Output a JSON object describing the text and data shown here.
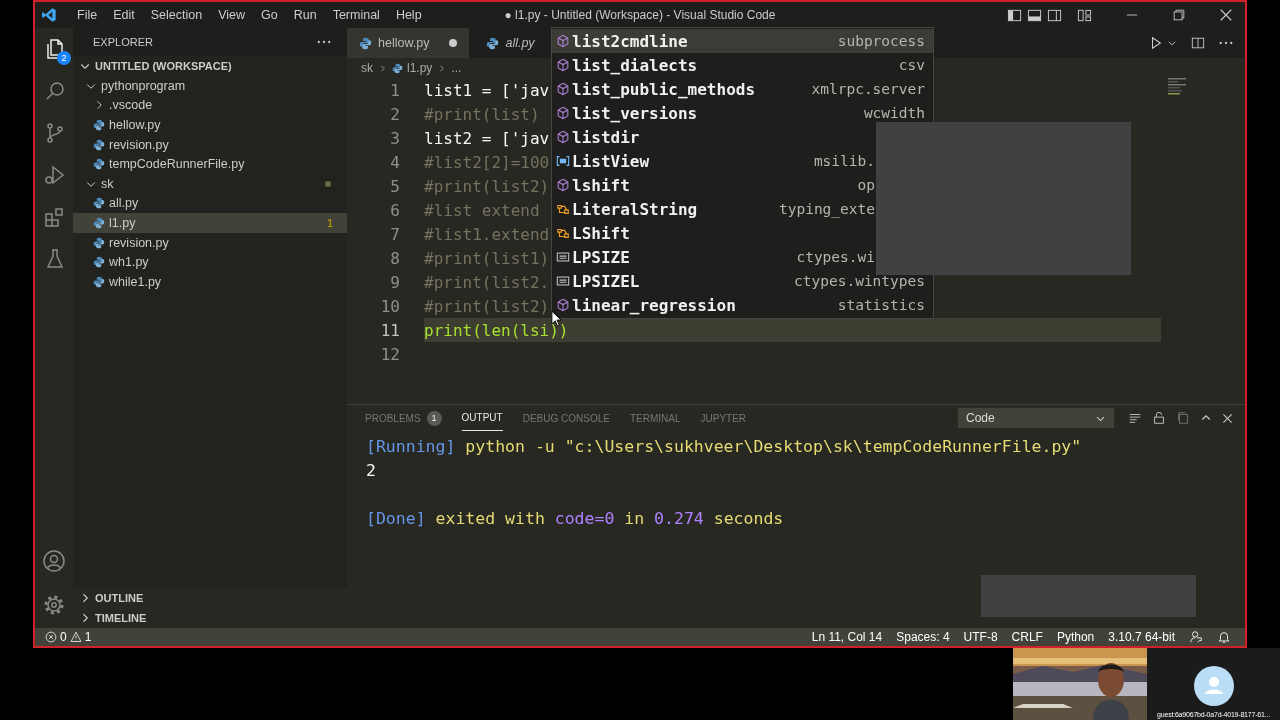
{
  "window": {
    "title": "● l1.py - Untitled (Workspace) - Visual Studio Code"
  },
  "menu": [
    "File",
    "Edit",
    "Selection",
    "View",
    "Go",
    "Run",
    "Terminal",
    "Help"
  ],
  "activity_bar": {
    "items": [
      {
        "kind": "explorer",
        "selected": true,
        "badge": "2"
      },
      {
        "kind": "search",
        "selected": false
      },
      {
        "kind": "source-control",
        "selected": false
      },
      {
        "kind": "run-debug",
        "selected": false
      },
      {
        "kind": "extensions",
        "selected": false
      },
      {
        "kind": "testing",
        "selected": false
      }
    ]
  },
  "sidebar": {
    "title": "EXPLORER",
    "workspace": {
      "label": "UNTITLED (WORKSPACE)",
      "expanded": true,
      "children": [
        {
          "kind": "folder",
          "label": "pythonprogram",
          "expanded": true,
          "selected": false,
          "children": [
            {
              "kind": "folder",
              "label": ".vscode",
              "expanded": false,
              "selected": false
            },
            {
              "kind": "file",
              "label": "hellow.py",
              "selected": false
            },
            {
              "kind": "file",
              "label": "revision.py",
              "selected": false
            },
            {
              "kind": "file",
              "label": "tempCodeRunnerFile.py",
              "selected": false
            }
          ]
        },
        {
          "kind": "folder",
          "label": "sk",
          "expanded": true,
          "selected": false,
          "modified": true,
          "children": [
            {
              "kind": "file",
              "label": "all.py",
              "selected": false
            },
            {
              "kind": "file",
              "label": "l1.py",
              "selected": true,
              "badge": "1"
            },
            {
              "kind": "file",
              "label": "revision.py",
              "selected": false
            },
            {
              "kind": "file",
              "label": "wh1.py",
              "selected": false
            },
            {
              "kind": "file",
              "label": "while1.py",
              "selected": false
            }
          ]
        }
      ]
    },
    "sections": [
      {
        "label": "OUTLINE",
        "expanded": false
      },
      {
        "label": "TIMELINE",
        "expanded": false
      }
    ]
  },
  "tabs": [
    {
      "label": "hellow.py",
      "selected": false,
      "dirty": true,
      "preview": false
    },
    {
      "label": "all.py",
      "selected": false,
      "dirty": false,
      "preview": true
    }
  ],
  "breadcrumb": [
    {
      "kind": "folder",
      "label": "sk"
    },
    {
      "kind": "file",
      "label": "l1.py"
    },
    {
      "kind": "symbol",
      "label": "..."
    }
  ],
  "editor": {
    "lines": [
      {
        "number": "1",
        "kind": "code",
        "text": "list1 = ['jav",
        "current": false
      },
      {
        "number": "2",
        "kind": "comment",
        "text": "#print(list)",
        "current": false
      },
      {
        "number": "3",
        "kind": "code",
        "text": "list2 = ['jav",
        "current": false
      },
      {
        "number": "4",
        "kind": "comment",
        "text": "#list2[2]=100",
        "current": false
      },
      {
        "number": "5",
        "kind": "comment",
        "text": "#print(list2)",
        "current": false
      },
      {
        "number": "6",
        "kind": "comment",
        "text": "#list extend",
        "current": false
      },
      {
        "number": "7",
        "kind": "comment",
        "text": "#list1.extend",
        "current": false
      },
      {
        "number": "8",
        "kind": "comment",
        "text": "#print(list1)",
        "current": false
      },
      {
        "number": "9",
        "kind": "comment",
        "text": "#print(list2.",
        "current": false
      },
      {
        "number": "10",
        "kind": "comment",
        "text": "#print(list2)",
        "current": false
      },
      {
        "number": "11",
        "kind": "call",
        "text": "print(len(lsi))",
        "current": true
      },
      {
        "number": "12",
        "current": false
      }
    ]
  },
  "suggestions": {
    "items": [
      {
        "kind": "module",
        "label": "list2cmdline",
        "detail": "subprocess",
        "selected": true,
        "clipped": false
      },
      {
        "kind": "module",
        "label": "list_dialects",
        "detail": "csv",
        "selected": false,
        "clipped": false
      },
      {
        "kind": "module",
        "label": "list_public_methods",
        "detail": "xmlrpc.server",
        "selected": false,
        "clipped": false
      },
      {
        "kind": "module",
        "label": "list_versions",
        "detail": "wcwidth",
        "selected": false,
        "clipped": false
      },
      {
        "kind": "module",
        "label": "listdir",
        "selected": false
      },
      {
        "kind": "variable",
        "label": "ListView",
        "detail": "msilib.",
        "selected": false,
        "clipped": true
      },
      {
        "kind": "module",
        "label": "lshift",
        "detail": "op",
        "selected": false,
        "clipped": true
      },
      {
        "kind": "class",
        "label": "LiteralString",
        "detail": "typing_exte",
        "selected": false,
        "clipped": true
      },
      {
        "kind": "class",
        "label": "LShift",
        "selected": false
      },
      {
        "kind": "constant",
        "label": "LPSIZE",
        "detail": "ctypes.wi",
        "selected": false,
        "clipped": true
      },
      {
        "kind": "constant",
        "label": "LPSIZEL",
        "detail": "ctypes.wintypes",
        "selected": false,
        "clipped": false
      },
      {
        "kind": "module",
        "label": "linear_regression",
        "detail": "statistics",
        "selected": false,
        "clipped": false
      }
    ]
  },
  "panel": {
    "tabs": [
      {
        "label": "PROBLEMS",
        "badge": "1",
        "selected": false
      },
      {
        "label": "OUTPUT",
        "selected": true
      },
      {
        "label": "DEBUG CONSOLE",
        "selected": false
      },
      {
        "label": "TERMINAL",
        "selected": false
      },
      {
        "label": "JUPYTER",
        "selected": false
      }
    ],
    "dropdown": "Code",
    "output": [
      {
        "lines": [
          {
            "segments": [
              {
                "kind": "tag",
                "text": "[Running]"
              },
              {
                "kind": "text",
                "text": " python -u \"c:\\Users\\sukhveer\\Desktop\\sk\\tempCodeRunnerFile.py\""
              }
            ]
          },
          {
            "segments": [
              {
                "kind": "plain",
                "text": "2"
              }
            ]
          }
        ]
      },
      {
        "lines": [
          {
            "segments": [
              {
                "kind": "tag",
                "text": "[Done]"
              },
              {
                "kind": "text",
                "text": " exited with "
              },
              {
                "kind": "number",
                "text": "code=0"
              },
              {
                "kind": "text",
                "text": " in "
              },
              {
                "kind": "number",
                "text": "0.274"
              },
              {
                "kind": "text",
                "text": " seconds"
              }
            ]
          }
        ]
      }
    ]
  },
  "status_bar": {
    "errors": "0",
    "warnings": "1",
    "items": [
      "Ln 11, Col 14",
      "Spaces: 4",
      "UTF-8",
      "CRLF",
      "Python",
      "3.10.7 64-bit"
    ]
  },
  "call": {
    "guest": "guest:6a9067bd-0a7d-4019-8177-61..."
  }
}
